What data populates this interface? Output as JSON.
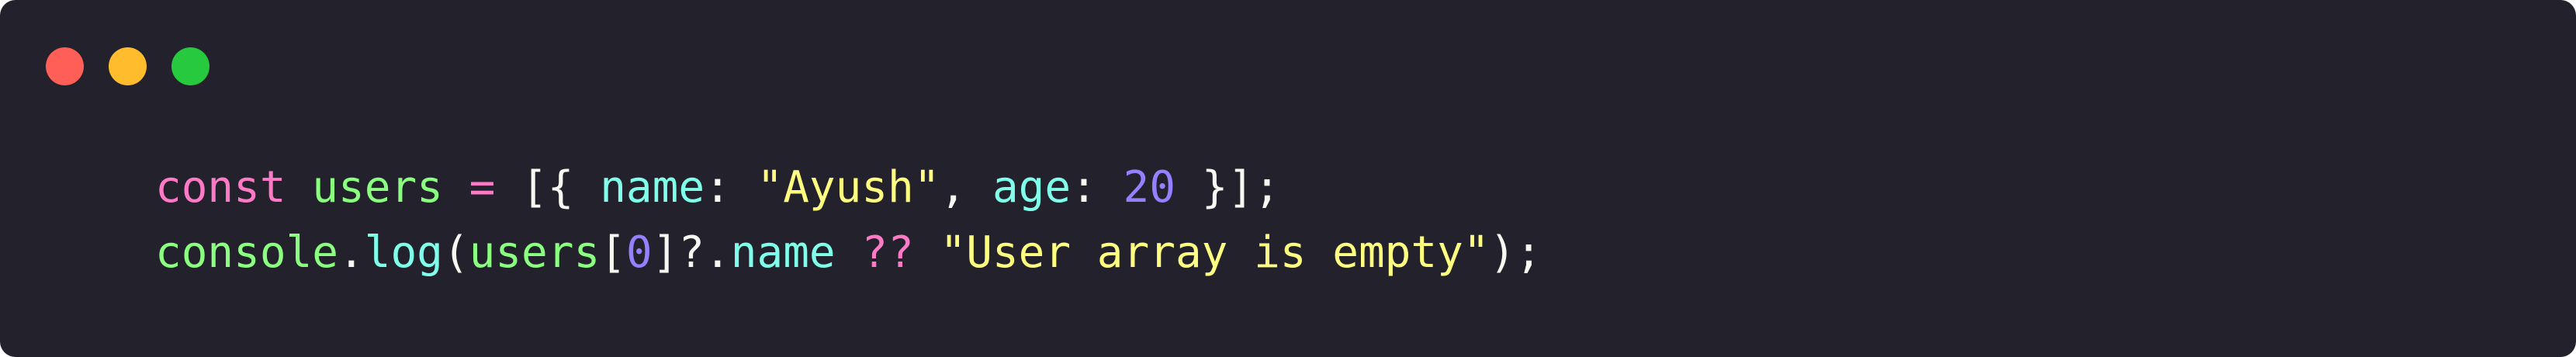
{
  "window": {
    "controls": [
      {
        "name": "close",
        "color": "#ff5f56"
      },
      {
        "name": "minimize",
        "color": "#ffbd2e"
      },
      {
        "name": "maximize",
        "color": "#27c93f"
      }
    ]
  },
  "colors": {
    "background": "#22212c",
    "keyword": "#ff7ac6",
    "variable": "#8aff80",
    "property": "#80ffea",
    "string": "#ffff80",
    "number": "#9580ff",
    "punctuation": "#f8f8f2"
  },
  "code": {
    "lines": [
      [
        {
          "text": "const",
          "type": "keyword"
        },
        {
          "text": " ",
          "type": "text"
        },
        {
          "text": "users",
          "type": "variable"
        },
        {
          "text": " ",
          "type": "text"
        },
        {
          "text": "=",
          "type": "operator"
        },
        {
          "text": " ",
          "type": "text"
        },
        {
          "text": "[{",
          "type": "punct"
        },
        {
          "text": " ",
          "type": "text"
        },
        {
          "text": "name",
          "type": "property"
        },
        {
          "text": ":",
          "type": "punct"
        },
        {
          "text": " ",
          "type": "text"
        },
        {
          "text": "\"Ayush\"",
          "type": "string"
        },
        {
          "text": ",",
          "type": "punct"
        },
        {
          "text": " ",
          "type": "text"
        },
        {
          "text": "age",
          "type": "property"
        },
        {
          "text": ":",
          "type": "punct"
        },
        {
          "text": " ",
          "type": "text"
        },
        {
          "text": "20",
          "type": "number"
        },
        {
          "text": " ",
          "type": "text"
        },
        {
          "text": "}];",
          "type": "punct"
        }
      ],
      [
        {
          "text": "console",
          "type": "variable"
        },
        {
          "text": ".",
          "type": "punct"
        },
        {
          "text": "log",
          "type": "method"
        },
        {
          "text": "(",
          "type": "punct"
        },
        {
          "text": "users",
          "type": "variable"
        },
        {
          "text": "[",
          "type": "punct"
        },
        {
          "text": "0",
          "type": "number"
        },
        {
          "text": "]?.",
          "type": "punct"
        },
        {
          "text": "name",
          "type": "property"
        },
        {
          "text": " ",
          "type": "text"
        },
        {
          "text": "??",
          "type": "operator"
        },
        {
          "text": " ",
          "type": "text"
        },
        {
          "text": "\"User array is empty\"",
          "type": "string"
        },
        {
          "text": ");",
          "type": "punct"
        }
      ]
    ]
  }
}
